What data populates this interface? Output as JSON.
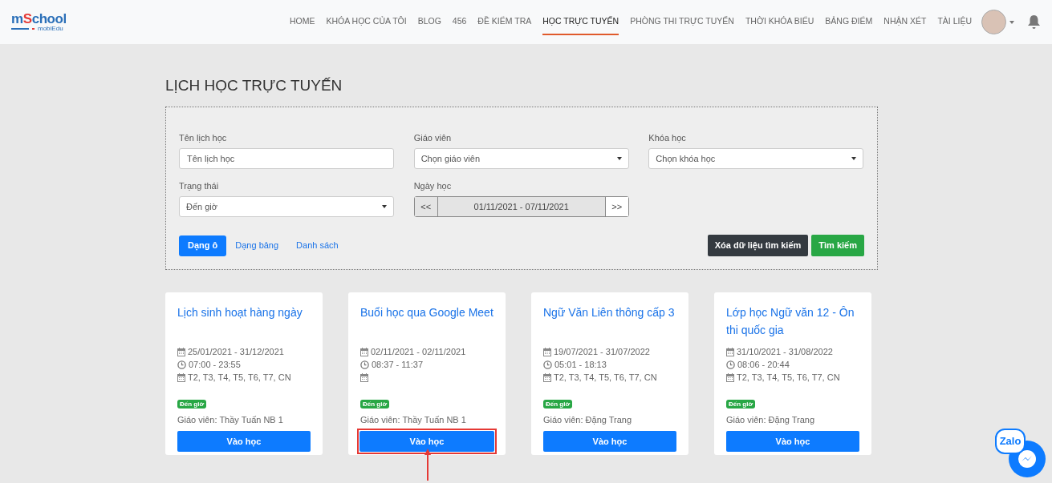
{
  "logo": {
    "parts": [
      "m",
      "S",
      "chool"
    ],
    "tagline": "mobiEdu"
  },
  "nav": [
    {
      "label": "HOME",
      "selected": false
    },
    {
      "label": "KHÓA HỌC CỦA TÔI",
      "selected": false
    },
    {
      "label": "BLOG",
      "selected": false
    },
    {
      "label": "456",
      "selected": false
    },
    {
      "label": "ĐỀ KIỂM TRA",
      "selected": false
    },
    {
      "label": "HỌC TRỰC TUYẾN",
      "selected": true
    },
    {
      "label": "PHÒNG THI TRỰC TUYẾN",
      "selected": false
    },
    {
      "label": "THỜI KHÓA BIỂU",
      "selected": false
    },
    {
      "label": "BẢNG ĐIỂM",
      "selected": false
    },
    {
      "label": "NHẬN XÉT",
      "selected": false
    },
    {
      "label": "TÀI LIỆU",
      "selected": false
    }
  ],
  "page_title": "LỊCH HỌC TRỰC TUYẾN",
  "filters": [
    {
      "kind": "text",
      "label": "Tên lịch học",
      "placeholder": "Tên lịch học"
    },
    {
      "kind": "select",
      "label": "Giáo viên",
      "value": "Chọn giáo viên"
    },
    {
      "kind": "select",
      "label": "Khóa học",
      "value": "Chọn khóa học"
    },
    {
      "kind": "select",
      "label": "Trạng thái",
      "value": "Đến giờ"
    },
    {
      "kind": "range",
      "label": "Ngày học",
      "prev": "<<",
      "value": "01/11/2021 - 07/11/2021",
      "next": ">>"
    }
  ],
  "views": [
    {
      "label": "Dạng ô",
      "selected": true
    },
    {
      "label": "Dạng bảng",
      "selected": false
    },
    {
      "label": "Danh sách",
      "selected": false
    }
  ],
  "actions": [
    {
      "kind": "clear",
      "label": "Xóa dữ liệu tìm kiếm"
    },
    {
      "kind": "search",
      "label": "Tìm kiếm"
    }
  ],
  "cards": [
    {
      "title": "Lịch sinh hoạt hàng ngày",
      "dates": "25/01/2021 - 31/12/2021",
      "time": "07:00 - 23:55",
      "days": "T2, T3, T4, T5, T6, T7, CN",
      "status": "Đến giờ",
      "teacher": "Giáo viên: Thầy Tuấn NB 1",
      "button": "Vào học",
      "highlighted": false
    },
    {
      "title": "Buổi học qua Google Meet",
      "dates": "02/11/2021 - 02/11/2021",
      "time": "08:37 - 11:37",
      "status": "Đến giờ",
      "teacher": "Giáo viên: Thầy Tuấn NB 1",
      "button": "Vào học",
      "highlighted": true
    },
    {
      "title": "Ngữ Văn Liên thông cấp 3",
      "dates": "19/07/2021 - 31/07/2022",
      "time": "05:01 - 18:13",
      "days": "T2, T3, T4, T5, T6, T7, CN",
      "status": "Đến giờ",
      "teacher": "Giáo viên: Đặng Trang",
      "button": "Vào học",
      "highlighted": false
    },
    {
      "title": "Lớp học Ngữ văn 12 - Ôn thi quốc gia",
      "dates": "31/10/2021 - 31/08/2022",
      "time": "08:06 - 20:44",
      "days": "T2, T3, T4, T5, T6, T7, CN",
      "status": "Đến giờ",
      "teacher": "Giáo viên: Đặng Trang",
      "button": "Vào học",
      "highlighted": false
    }
  ],
  "zalo": {
    "label": "Zalo"
  }
}
